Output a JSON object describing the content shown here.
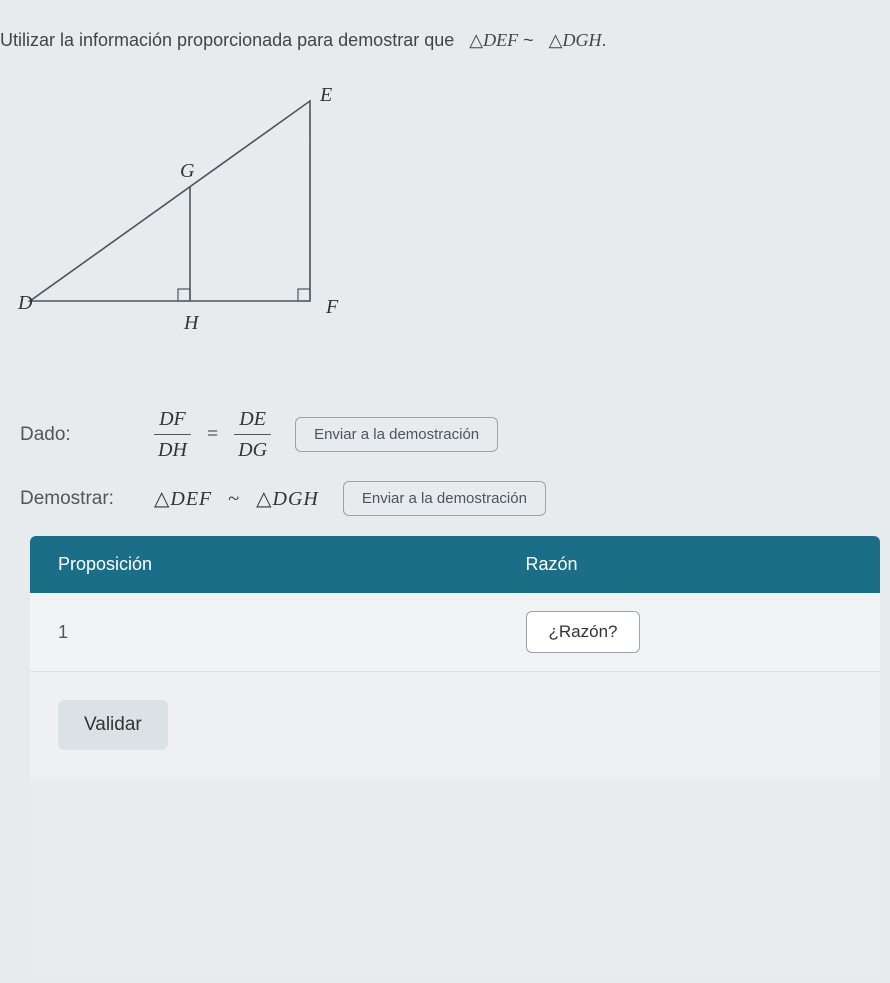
{
  "instruction": {
    "prefix": "Utilizar la información proporcionada para demostrar que",
    "tri1": "DEF",
    "rel": "~",
    "tri2": "DGH",
    "suffix": "."
  },
  "diagram": {
    "points": {
      "D": "D",
      "E": "E",
      "F": "F",
      "G": "G",
      "H": "H"
    }
  },
  "given": {
    "label": "Dado:",
    "lhs_num": "DF",
    "lhs_den": "DH",
    "eq": "=",
    "rhs_num": "DE",
    "rhs_den": "DG",
    "send": "Enviar a la demostración"
  },
  "prove": {
    "label": "Demostrar:",
    "tri1": "DEF",
    "rel": "~",
    "tri2": "DGH",
    "send": "Enviar a la demostración"
  },
  "table": {
    "header_prop": "Proposición",
    "header_reason": "Razón",
    "rows": [
      {
        "index": "1",
        "reason_btn": "¿Razón?"
      }
    ],
    "validate": "Validar"
  }
}
